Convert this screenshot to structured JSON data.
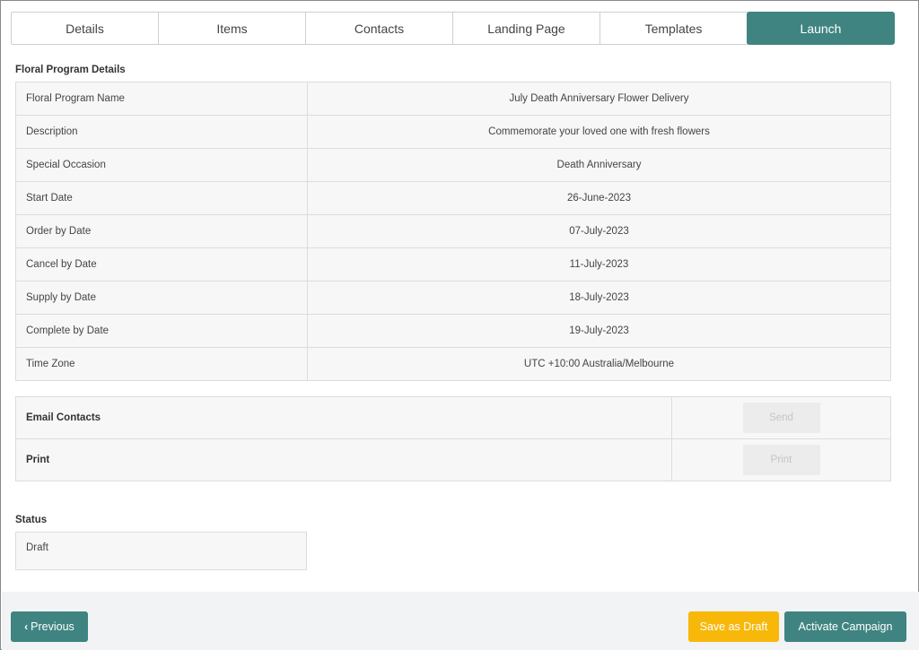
{
  "tabs": [
    {
      "label": "Details"
    },
    {
      "label": "Items"
    },
    {
      "label": "Contacts"
    },
    {
      "label": "Landing Page"
    },
    {
      "label": "Templates"
    },
    {
      "label": "Launch",
      "active": true
    }
  ],
  "section_title": "Floral Program Details",
  "details": [
    {
      "label": "Floral Program Name",
      "value": "July Death Anniversary Flower Delivery"
    },
    {
      "label": "Description",
      "value": "Commemorate your loved one with fresh flowers"
    },
    {
      "label": "Special Occasion",
      "value": "Death Anniversary"
    },
    {
      "label": "Start Date",
      "value": "26-June-2023"
    },
    {
      "label": "Order by Date",
      "value": "07-July-2023"
    },
    {
      "label": "Cancel by Date",
      "value": "11-July-2023"
    },
    {
      "label": "Supply by Date",
      "value": "18-July-2023"
    },
    {
      "label": "Complete by Date",
      "value": "19-July-2023"
    },
    {
      "label": "Time Zone",
      "value": "UTC +10:00 Australia/Melbourne"
    }
  ],
  "actions": [
    {
      "label": "Email Contacts",
      "button": "Send"
    },
    {
      "label": "Print",
      "button": "Print"
    }
  ],
  "status": {
    "label": "Status",
    "value": "Draft"
  },
  "footer": {
    "previous": "Previous",
    "save_draft": "Save as Draft",
    "activate": "Activate Campaign"
  },
  "colors": {
    "accent": "#3f8481",
    "warning": "#f7b80a"
  }
}
